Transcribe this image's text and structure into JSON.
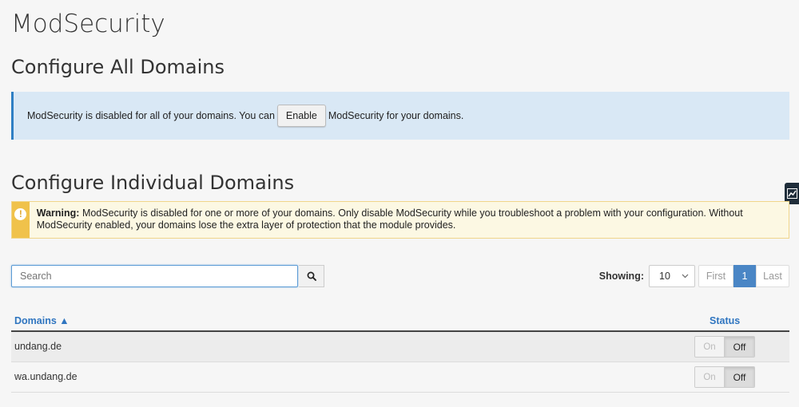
{
  "page": {
    "title": "ModSecurity"
  },
  "configure_all": {
    "heading": "Configure All Domains",
    "text_before": "ModSecurity is disabled for all of your domains. You can",
    "enable_label": "Enable",
    "text_after": "ModSecurity for your domains."
  },
  "configure_individual": {
    "heading": "Configure Individual Domains",
    "warning_label": "Warning:",
    "warning_text": " ModSecurity is disabled for one or more of your domains. Only disable ModSecurity while you troubleshoot a problem with your configuration. Without ModSecurity enabled, your domains lose the extra layer of protection that the module provides.",
    "warning_icon": "exclamation-icon"
  },
  "search": {
    "placeholder": "Search",
    "value": "",
    "button_icon": "search-icon"
  },
  "pagination": {
    "showing_label": "Showing:",
    "page_size": "10",
    "first_label": "First",
    "current_page": "1",
    "last_label": "Last"
  },
  "table": {
    "columns": {
      "domains": "Domains ▲",
      "status": "Status"
    },
    "rows": [
      {
        "domain": "undang.de",
        "on_label": "On",
        "off_label": "Off",
        "status": "Off"
      },
      {
        "domain": "wa.undang.de",
        "on_label": "On",
        "off_label": "Off",
        "status": "Off"
      }
    ]
  },
  "side_tab": {
    "icon": "chart-icon"
  },
  "colors": {
    "accent": "#2f75c0",
    "info_bg": "#d9e8f5",
    "warning_bg": "#fcf8e3",
    "warning_accent": "#f0c24b",
    "active_page": "#4a86c5"
  }
}
